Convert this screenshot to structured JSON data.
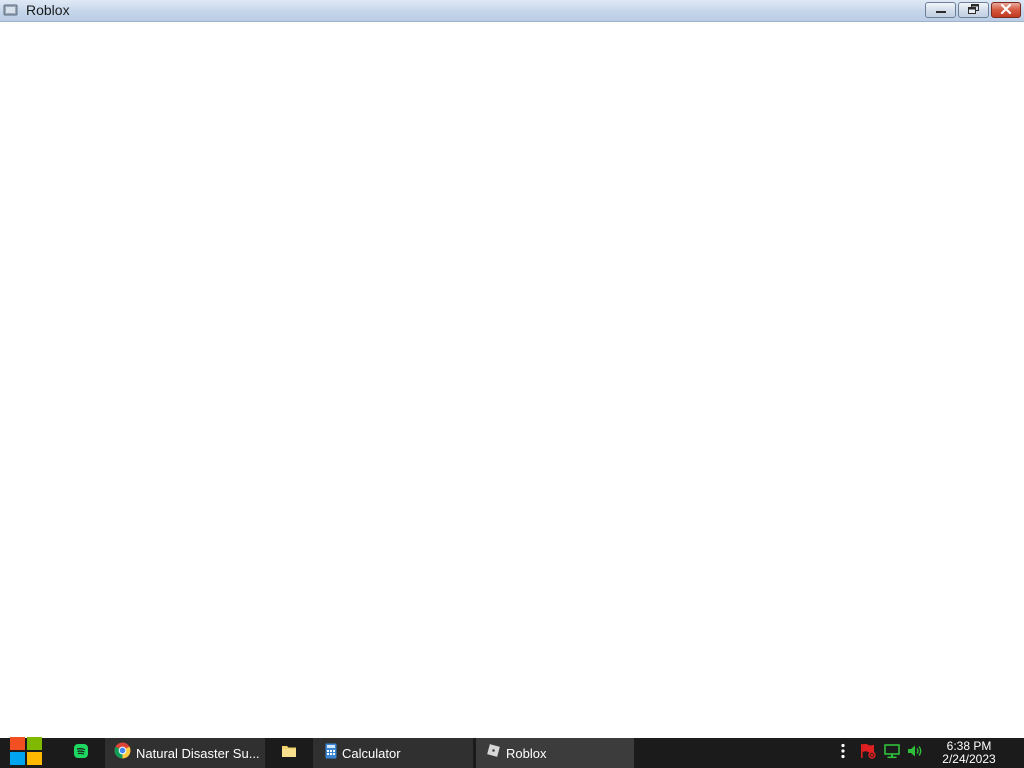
{
  "window": {
    "title": "Roblox",
    "icon": "roblox-window-icon",
    "controls": {
      "minimize": "minimize-icon",
      "maximize": "restore-icon",
      "close": "close-icon"
    }
  },
  "taskbar": {
    "start": {
      "icon": "windows-logo-icon"
    },
    "items": [
      {
        "id": "spotify",
        "icon": "spotify-icon",
        "label": ""
      },
      {
        "id": "chrome",
        "icon": "chrome-icon",
        "label": "Natural Disaster Su..."
      },
      {
        "id": "files",
        "icon": "folder-icon",
        "label": ""
      },
      {
        "id": "calculator",
        "icon": "calculator-icon",
        "label": "Calculator"
      },
      {
        "id": "roblox",
        "icon": "roblox-icon",
        "label": "Roblox"
      }
    ],
    "tray": {
      "icons": [
        "more-icon",
        "flag-icon",
        "network-icon",
        "volume-icon"
      ],
      "time": "6:38 PM",
      "date": "2/24/2023"
    }
  },
  "colors": {
    "taskbar": "#1b1b1b",
    "active_item": "#3c3c3c",
    "titlebar": "#c5d6ea",
    "close_button": "#c23a22",
    "tray_green": "#2fbf3a",
    "flag_red": "#e02020"
  }
}
